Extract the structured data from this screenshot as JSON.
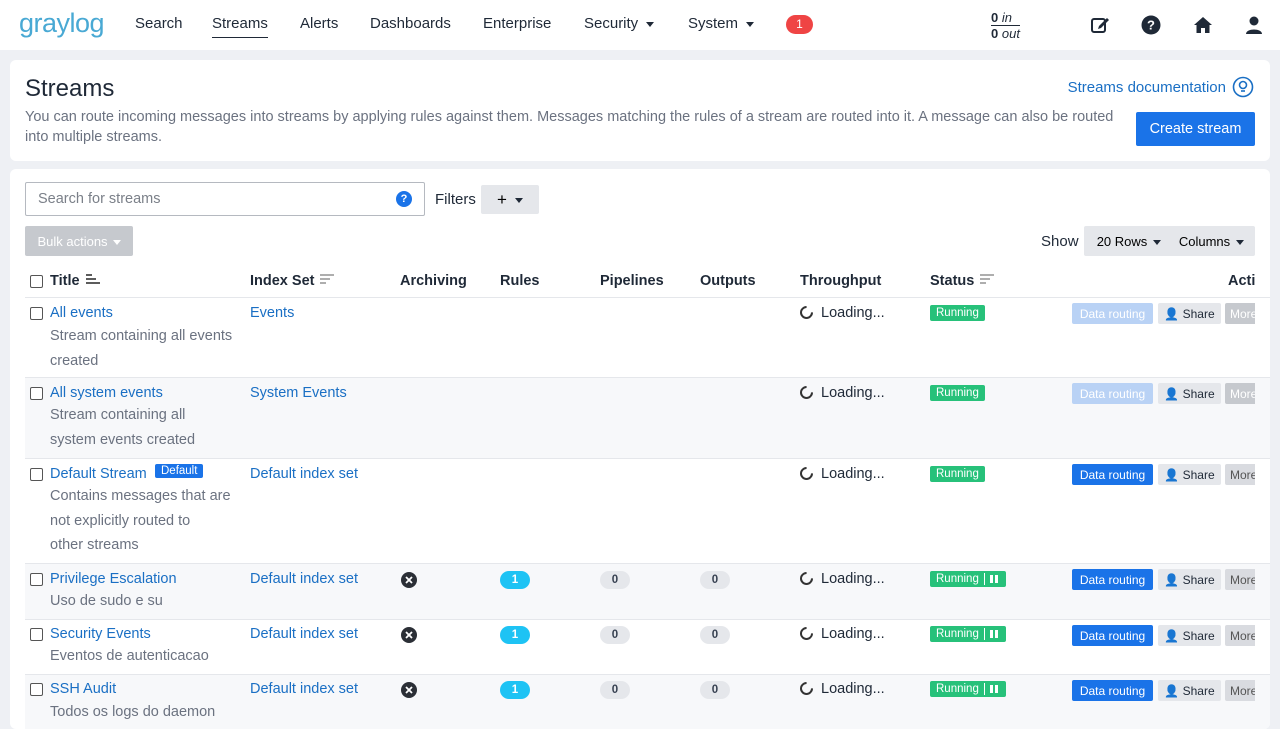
{
  "nav": {
    "logo": "graylog",
    "items": [
      "Search",
      "Streams",
      "Alerts",
      "Dashboards",
      "Enterprise",
      "Security",
      "System"
    ],
    "notifications": "1",
    "throughput_in": "0",
    "throughput_in_label": "in",
    "throughput_out": "0",
    "throughput_out_label": "out",
    "icons": [
      "edit-icon",
      "help-icon",
      "home-icon",
      "user-icon"
    ]
  },
  "header": {
    "title": "Streams",
    "description": "You can route incoming messages into streams by applying rules against them. Messages matching the rules of a stream are routed into it. A message can also be routed into multiple streams.",
    "doc_link": "Streams documentation",
    "create_button": "Create stream"
  },
  "toolbar": {
    "search_placeholder": "Search for streams",
    "filters_label": "Filters",
    "bulk_actions": "Bulk actions",
    "show_label": "Show",
    "rows_button": "20 Rows",
    "columns_button": "Columns"
  },
  "table": {
    "columns": [
      "Title",
      "Index Set",
      "Archiving",
      "Rules",
      "Pipelines",
      "Outputs",
      "Throughput",
      "Status",
      "Acti"
    ],
    "rows": [
      {
        "title": "All events",
        "desc": [
          "Stream containing all events",
          "created"
        ],
        "index_set": "Events",
        "rules": "",
        "pipelines": "",
        "outputs": "",
        "throughput": "Loading...",
        "status": "Running",
        "data_routing": "Data routing",
        "share": "Share",
        "more": "More"
      },
      {
        "title": "All system events",
        "desc": [
          "Stream containing all",
          "system events created"
        ],
        "index_set": "System Events",
        "rules": "",
        "pipelines": "",
        "outputs": "",
        "throughput": "Loading...",
        "status": "Running",
        "data_routing": "Data routing",
        "share": "Share",
        "more": "More"
      },
      {
        "title": "Default Stream",
        "badge": "Default",
        "desc": [
          "Contains messages that are",
          "not explicitly routed to",
          "other streams"
        ],
        "index_set": "Default index set",
        "rules": "",
        "pipelines": "",
        "outputs": "",
        "throughput": "Loading...",
        "status": "Running",
        "data_routing": "Data routing",
        "share": "Share",
        "more": "More"
      },
      {
        "title": "Privilege Escalation",
        "desc": [
          "Uso de sudo e su"
        ],
        "index_set": "Default index set",
        "rules": "1",
        "pipelines": "0",
        "outputs": "0",
        "throughput": "Loading...",
        "status": "Running",
        "data_routing": "Data routing",
        "share": "Share",
        "more": "More"
      },
      {
        "title": "Security Events",
        "desc": [
          "Eventos de autenticacao"
        ],
        "index_set": "Default index set",
        "rules": "1",
        "pipelines": "0",
        "outputs": "0",
        "throughput": "Loading...",
        "status": "Running",
        "data_routing": "Data routing",
        "share": "Share",
        "more": "More"
      },
      {
        "title": "SSH Audit",
        "desc": [
          "Todos os logs do daemon"
        ],
        "index_set": "Default index set",
        "rules": "1",
        "pipelines": "0",
        "outputs": "0",
        "throughput": "Loading...",
        "status": "Running",
        "data_routing": "Data routing",
        "share": "Share",
        "more": "More"
      }
    ]
  }
}
